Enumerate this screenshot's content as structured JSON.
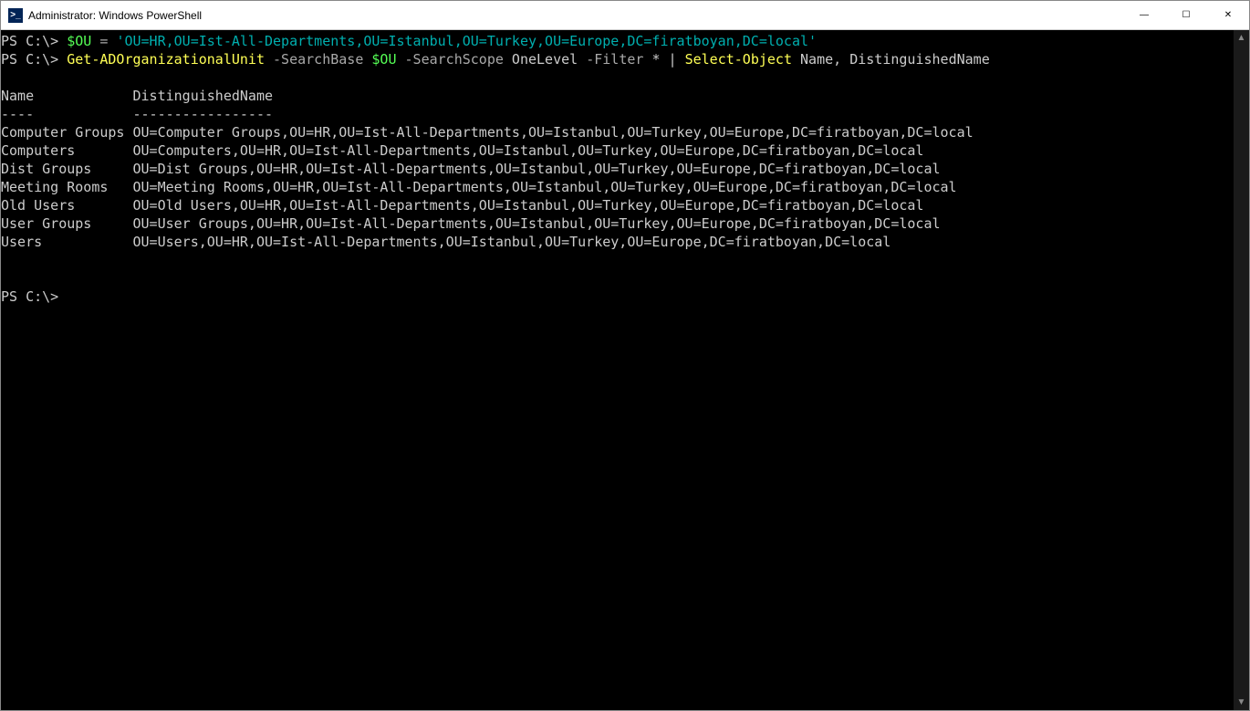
{
  "window": {
    "title": "Administrator: Windows PowerShell",
    "icon_label": ">_"
  },
  "controls": {
    "minimize": "—",
    "maximize": "☐",
    "close": "✕"
  },
  "prompt": "PS C:\\>",
  "commands": {
    "line1": {
      "var": "$OU",
      "op": " = ",
      "value": "'OU=HR,OU=Ist-All-Departments,OU=Istanbul,OU=Turkey,OU=Europe,DC=firatboyan,DC=local'"
    },
    "line2": {
      "cmd": "Get-ADOrganizationalUnit",
      "p1": " -SearchBase",
      "v1": " $OU",
      "p2": " -SearchScope",
      "v2": " OneLevel",
      "p3": " -Filter",
      "v3": " *",
      "pipe": " | ",
      "cmd2": "Select-Object",
      "args2": " Name, DistinguishedName"
    }
  },
  "output": {
    "header_name": "Name",
    "header_dn": "DistinguishedName",
    "sep_name": "----",
    "sep_dn": "-----------------",
    "col1_width": 16,
    "rows": [
      {
        "name": "Computer Groups",
        "dn": "OU=Computer Groups,OU=HR,OU=Ist-All-Departments,OU=Istanbul,OU=Turkey,OU=Europe,DC=firatboyan,DC=local"
      },
      {
        "name": "Computers",
        "dn": "OU=Computers,OU=HR,OU=Ist-All-Departments,OU=Istanbul,OU=Turkey,OU=Europe,DC=firatboyan,DC=local"
      },
      {
        "name": "Dist Groups",
        "dn": "OU=Dist Groups,OU=HR,OU=Ist-All-Departments,OU=Istanbul,OU=Turkey,OU=Europe,DC=firatboyan,DC=local"
      },
      {
        "name": "Meeting Rooms",
        "dn": "OU=Meeting Rooms,OU=HR,OU=Ist-All-Departments,OU=Istanbul,OU=Turkey,OU=Europe,DC=firatboyan,DC=local"
      },
      {
        "name": "Old Users",
        "dn": "OU=Old Users,OU=HR,OU=Ist-All-Departments,OU=Istanbul,OU=Turkey,OU=Europe,DC=firatboyan,DC=local"
      },
      {
        "name": "User Groups",
        "dn": "OU=User Groups,OU=HR,OU=Ist-All-Departments,OU=Istanbul,OU=Turkey,OU=Europe,DC=firatboyan,DC=local"
      },
      {
        "name": "Users",
        "dn": "OU=Users,OU=HR,OU=Ist-All-Departments,OU=Istanbul,OU=Turkey,OU=Europe,DC=firatboyan,DC=local"
      }
    ]
  },
  "scroll": {
    "up": "▲",
    "down": "▼"
  }
}
